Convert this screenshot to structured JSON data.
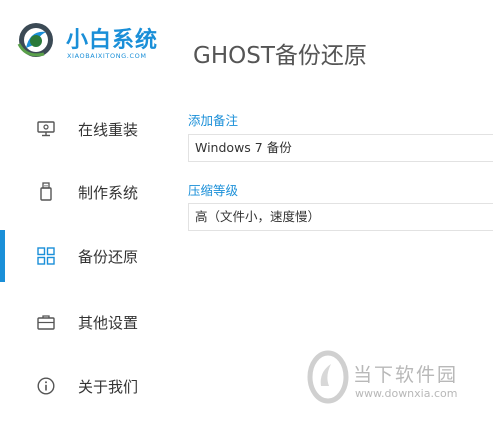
{
  "brand": {
    "name": "小白系统",
    "subtitle": "XIAOBAIXITONG.COM",
    "color": "#1a8fd8"
  },
  "page": {
    "title": "GHOST备份还原"
  },
  "sidebar": {
    "items": [
      {
        "label": "在线重装",
        "icon": "monitor-icon",
        "active": false
      },
      {
        "label": "制作系统",
        "icon": "usb-icon",
        "active": false
      },
      {
        "label": "备份还原",
        "icon": "grid-icon",
        "active": true
      },
      {
        "label": "其他设置",
        "icon": "briefcase-icon",
        "active": false
      },
      {
        "label": "关于我们",
        "icon": "info-icon",
        "active": false
      }
    ]
  },
  "form": {
    "note": {
      "label": "添加备注",
      "value": "Windows 7 备份"
    },
    "compression": {
      "label": "压缩等级",
      "value": "高（文件小，速度慢）"
    }
  },
  "watermark": {
    "name": "当下软件园",
    "url": "www.downxia.com"
  }
}
